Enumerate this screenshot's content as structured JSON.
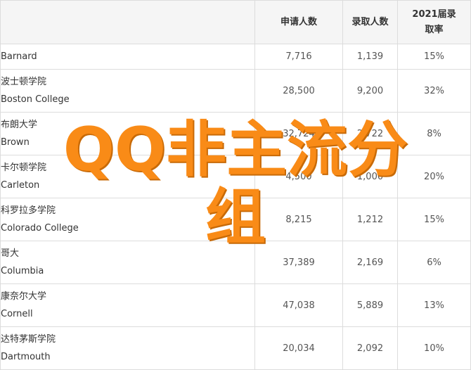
{
  "table": {
    "columns": [
      "",
      "申请人数",
      "录取人数",
      "2021届录取率"
    ],
    "rows": [
      {
        "zh": "",
        "en": "Barnard",
        "applicants": "7,716",
        "admitted": "1,139",
        "rate": "15%"
      },
      {
        "zh": "波士顿学院",
        "en": "Boston College",
        "applicants": "28,500",
        "admitted": "9,200",
        "rate": "32%"
      },
      {
        "zh": "布朗大学",
        "en": "Brown",
        "applicants": "32,724",
        "admitted": "2,722",
        "rate": "8%"
      },
      {
        "zh": "卡尔顿学院",
        "en": "Carleton",
        "applicants": "4,500",
        "admitted": "1,000",
        "rate": "20%"
      },
      {
        "zh": "科罗拉多学院",
        "en": "Colorado College",
        "applicants": "8,215",
        "admitted": "1,212",
        "rate": "15%"
      },
      {
        "zh": "哥大",
        "en": "Columbia",
        "applicants": "37,389",
        "admitted": "2,169",
        "rate": "6%"
      },
      {
        "zh": "康奈尔大学",
        "en": "Cornell",
        "applicants": "47,038",
        "admitted": "5,889",
        "rate": "13%"
      },
      {
        "zh": "达特茅斯学院",
        "en": "Dartmouth",
        "applicants": "20,034",
        "admitted": "2,092",
        "rate": "10%"
      }
    ]
  },
  "watermark": {
    "line1": "QQ非主流分",
    "line2": "组"
  }
}
